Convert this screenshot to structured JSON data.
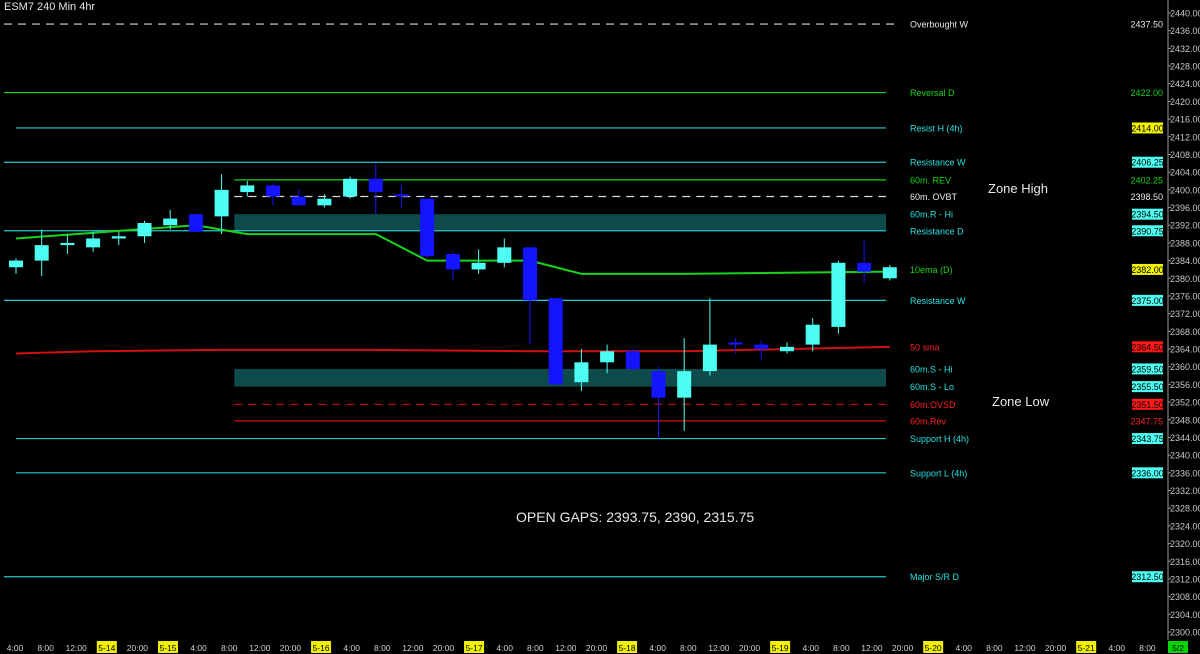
{
  "header": {
    "title": "ESM7 240 Min  4hr"
  },
  "notes": {
    "zone_high": "Zone High",
    "zone_low": "Zone Low",
    "open_gaps": "OPEN GAPS: 2393.75, 2390, 2315.75"
  },
  "colors": {
    "background": "#000000",
    "cyan": "#28c8c8",
    "green": "#19d419",
    "red": "#d01010",
    "bull_candle": "#4dfff2",
    "bear_candle": "#1414ff",
    "zone_fill": "#0f4a4a",
    "yellow_badge": "#f2f200",
    "red_badge": "#ff1a1a"
  },
  "chart_data": {
    "type": "candlestick",
    "title": "ESM7 240 Min  4hr",
    "ylim": [
      2298,
      2440
    ],
    "y_ticks": [
      2300,
      2304,
      2308,
      2312,
      2316,
      2320,
      2324,
      2328,
      2332,
      2336,
      2340,
      2344,
      2348,
      2352,
      2356,
      2360,
      2364,
      2368,
      2372,
      2376,
      2380,
      2384,
      2388,
      2392,
      2396,
      2400,
      2404,
      2408,
      2412,
      2416,
      2420,
      2424,
      2428,
      2432,
      2436,
      2440
    ],
    "x_tick_labels": [
      {
        "label": "4:00",
        "hl": false
      },
      {
        "label": "8:00",
        "hl": false
      },
      {
        "label": "12:00",
        "hl": false
      },
      {
        "label": "5-14",
        "hl": true
      },
      {
        "label": "20:00",
        "hl": false
      },
      {
        "label": "5-15",
        "hl": true
      },
      {
        "label": "4:00",
        "hl": false
      },
      {
        "label": "8:00",
        "hl": false
      },
      {
        "label": "12:00",
        "hl": false
      },
      {
        "label": "20:00",
        "hl": false
      },
      {
        "label": "5-16",
        "hl": true
      },
      {
        "label": "4:00",
        "hl": false
      },
      {
        "label": "8:00",
        "hl": false
      },
      {
        "label": "12:00",
        "hl": false
      },
      {
        "label": "20:00",
        "hl": false
      },
      {
        "label": "5-17",
        "hl": true
      },
      {
        "label": "4:00",
        "hl": false
      },
      {
        "label": "8:00",
        "hl": false
      },
      {
        "label": "12:00",
        "hl": false
      },
      {
        "label": "20:00",
        "hl": false
      },
      {
        "label": "5-18",
        "hl": true
      },
      {
        "label": "4:00",
        "hl": false
      },
      {
        "label": "8:00",
        "hl": false
      },
      {
        "label": "12:00",
        "hl": false
      },
      {
        "label": "20:00",
        "hl": false
      },
      {
        "label": "5-19",
        "hl": true
      },
      {
        "label": "4:00",
        "hl": false
      },
      {
        "label": "8:00",
        "hl": false
      },
      {
        "label": "12:00",
        "hl": false
      },
      {
        "label": "20:00",
        "hl": false
      },
      {
        "label": "5-20",
        "hl": true
      },
      {
        "label": "4:00",
        "hl": false
      },
      {
        "label": "8:00",
        "hl": false
      },
      {
        "label": "12:00",
        "hl": false
      },
      {
        "label": "20:00",
        "hl": false
      },
      {
        "label": "5-21",
        "hl": true
      },
      {
        "label": "4:00",
        "hl": false
      },
      {
        "label": "8:00",
        "hl": false
      },
      {
        "label": "5/2",
        "hl": "green"
      }
    ],
    "candles": [
      {
        "i": 0,
        "o": 2382.5,
        "h": 2384.5,
        "l": 2381.0,
        "c": 2384.0
      },
      {
        "i": 1,
        "o": 2384.0,
        "h": 2391.0,
        "l": 2380.5,
        "c": 2387.5
      },
      {
        "i": 2,
        "o": 2387.5,
        "h": 2390.0,
        "l": 2385.5,
        "c": 2388.0
      },
      {
        "i": 3,
        "o": 2387.0,
        "h": 2390.5,
        "l": 2386.0,
        "c": 2389.0
      },
      {
        "i": 4,
        "o": 2389.0,
        "h": 2390.5,
        "l": 2387.5,
        "c": 2389.5
      },
      {
        "i": 5,
        "o": 2389.5,
        "h": 2393.0,
        "l": 2388.0,
        "c": 2392.5
      },
      {
        "i": 6,
        "o": 2392.0,
        "h": 2395.5,
        "l": 2391.0,
        "c": 2393.5
      },
      {
        "i": 7,
        "o": 2394.5,
        "h": 2394.5,
        "l": 2390.5,
        "c": 2390.5
      },
      {
        "i": 8,
        "o": 2394.0,
        "h": 2403.5,
        "l": 2390.0,
        "c": 2400.0
      },
      {
        "i": 9,
        "o": 2399.5,
        "h": 2402.0,
        "l": 2398.5,
        "c": 2401.0
      },
      {
        "i": 10,
        "o": 2401.0,
        "h": 2401.5,
        "l": 2396.5,
        "c": 2398.5
      },
      {
        "i": 11,
        "o": 2398.5,
        "h": 2400.0,
        "l": 2397.0,
        "c": 2396.5
      },
      {
        "i": 12,
        "o": 2396.5,
        "h": 2399.0,
        "l": 2396.0,
        "c": 2398.0
      },
      {
        "i": 13,
        "o": 2398.5,
        "h": 2403.0,
        "l": 2398.0,
        "c": 2402.5
      },
      {
        "i": 14,
        "o": 2402.5,
        "h": 2406.0,
        "l": 2394.5,
        "c": 2399.5
      },
      {
        "i": 15,
        "o": 2399.0,
        "h": 2401.0,
        "l": 2396.0,
        "c": 2398.5
      },
      {
        "i": 16,
        "o": 2398.0,
        "h": 2398.0,
        "l": 2384.5,
        "c": 2385.0
      },
      {
        "i": 17,
        "o": 2385.5,
        "h": 2386.0,
        "l": 2379.5,
        "c": 2382.0
      },
      {
        "i": 18,
        "o": 2382.0,
        "h": 2386.5,
        "l": 2381.0,
        "c": 2383.5
      },
      {
        "i": 19,
        "o": 2383.5,
        "h": 2389.0,
        "l": 2382.5,
        "c": 2387.0
      },
      {
        "i": 20,
        "o": 2387.0,
        "h": 2387.0,
        "l": 2365.0,
        "c": 2375.0
      },
      {
        "i": 21,
        "o": 2375.5,
        "h": 2375.5,
        "l": 2356.0,
        "c": 2356.0
      },
      {
        "i": 22,
        "o": 2356.5,
        "h": 2364.0,
        "l": 2354.5,
        "c": 2361.0
      },
      {
        "i": 23,
        "o": 2361.0,
        "h": 2365.0,
        "l": 2358.5,
        "c": 2363.5
      },
      {
        "i": 24,
        "o": 2363.5,
        "h": 2364.0,
        "l": 2359.0,
        "c": 2359.5
      },
      {
        "i": 25,
        "o": 2359.0,
        "h": 2360.0,
        "l": 2343.5,
        "c": 2353.0
      },
      {
        "i": 26,
        "o": 2353.0,
        "h": 2366.5,
        "l": 2345.5,
        "c": 2359.0
      },
      {
        "i": 27,
        "o": 2359.0,
        "h": 2375.5,
        "l": 2358.0,
        "c": 2365.0
      },
      {
        "i": 28,
        "o": 2365.5,
        "h": 2366.5,
        "l": 2363.0,
        "c": 2365.0
      },
      {
        "i": 29,
        "o": 2365.0,
        "h": 2366.0,
        "l": 2361.5,
        "c": 2364.0
      },
      {
        "i": 30,
        "o": 2363.5,
        "h": 2365.5,
        "l": 2363.0,
        "c": 2364.5
      },
      {
        "i": 31,
        "o": 2365.0,
        "h": 2371.0,
        "l": 2363.5,
        "c": 2369.5
      },
      {
        "i": 32,
        "o": 2369.0,
        "h": 2384.0,
        "l": 2367.5,
        "c": 2383.5
      },
      {
        "i": 33,
        "o": 2383.5,
        "h": 2388.5,
        "l": 2379.0,
        "c": 2381.5
      },
      {
        "i": 34,
        "o": 2380.0,
        "h": 2383.0,
        "l": 2379.5,
        "c": 2382.5
      }
    ],
    "series": [
      {
        "name": "10ema (D)",
        "points": [
          [
            0,
            2389
          ],
          [
            7,
            2392
          ],
          [
            9,
            2390
          ],
          [
            14,
            2390
          ],
          [
            16,
            2384
          ],
          [
            20,
            2384
          ],
          [
            22,
            2381
          ],
          [
            26,
            2381
          ],
          [
            34,
            2381.5
          ]
        ]
      },
      {
        "name": "50 sma",
        "points": [
          [
            0,
            2363
          ],
          [
            3,
            2363.5
          ],
          [
            8,
            2363.8
          ],
          [
            14,
            2363.8
          ],
          [
            20,
            2363.5
          ],
          [
            26,
            2363.5
          ],
          [
            34,
            2364.5
          ]
        ]
      }
    ],
    "levels": [
      {
        "label": "Overbought W",
        "value": 2437.5,
        "value_text": "2437.50",
        "style": "dash",
        "color": "#d8d8d8",
        "badge": "none",
        "x0": 0,
        "label_color": "#e8e8e8"
      },
      {
        "label": "Reversal D",
        "value": 2422,
        "value_text": "2422.00",
        "style": "solid",
        "color": "#19d419",
        "badge": "none",
        "x0": 0,
        "label_color": "#19d419",
        "value_color": "#19d419"
      },
      {
        "label": "Resist H (4h)",
        "value": 2414,
        "value_text": "2414.00",
        "style": "solid",
        "color": "#28c8c8",
        "badge": "yellow",
        "x0": 0.5,
        "label_color": "#28e0e0"
      },
      {
        "label": "Resistance W",
        "value": 2406.25,
        "value_text": "2406.25",
        "style": "solid",
        "color": "#28c8c8",
        "badge": "cyan",
        "x0": 0,
        "label_color": "#28e0e0"
      },
      {
        "label": "60m. REV",
        "value": 2402.25,
        "value_text": "2402.25",
        "style": "solid",
        "color": "#19d419",
        "badge": "none",
        "x0": 9,
        "label_color": "#19d419",
        "value_color": "#19d419"
      },
      {
        "label": "60m. OVBT",
        "value": 2398.5,
        "value_text": "2398.50",
        "style": "dash",
        "color": "#d8d8d8",
        "badge": "none",
        "x0": 9,
        "label_color": "#e8e8e8"
      },
      {
        "label": "60m.R - Hi",
        "value": 2394.5,
        "value_text": "2394.50",
        "style": "none",
        "color": "#28c8c8",
        "badge": "cyan",
        "x0": 9,
        "label_color": "#28e0e0"
      },
      {
        "label": "Resistance D",
        "value": 2390.75,
        "value_text": "2390.75",
        "style": "solid",
        "color": "#28c8c8",
        "badge": "cyan",
        "x0": 0,
        "label_color": "#28e0e0"
      },
      {
        "label": "10ema (D)",
        "value": 2382,
        "value_text": "2382.00",
        "style": "none",
        "color": "#19d419",
        "badge": "yellow",
        "x0": 0,
        "label_color": "#19d419"
      },
      {
        "label": "Resistance W",
        "value": 2375,
        "value_text": "2375.00",
        "style": "solid",
        "color": "#28c8c8",
        "badge": "cyan",
        "x0": 0,
        "label_color": "#28e0e0"
      },
      {
        "label": "50 sma",
        "value": 2364.5,
        "value_text": "2364.50",
        "style": "none",
        "color": "#d01010",
        "badge": "red",
        "x0": 0,
        "label_color": "#ff2020"
      },
      {
        "label": "60m.S - Hi",
        "value": 2359.5,
        "value_text": "2359.50",
        "style": "none",
        "color": "#28c8c8",
        "badge": "cyan",
        "x0": 9,
        "label_color": "#28e0e0"
      },
      {
        "label": "60m.S - Lo",
        "value": 2355.5,
        "value_text": "2355.50",
        "style": "none",
        "color": "#28c8c8",
        "badge": "cyan",
        "x0": 9,
        "label_color": "#28e0e0"
      },
      {
        "label": "60m.OVSD",
        "value": 2351.5,
        "value_text": "2351.50",
        "style": "dash",
        "color": "#d01010",
        "badge": "red",
        "x0": 9,
        "label_color": "#ff2020"
      },
      {
        "label": "60m.Rev",
        "value": 2347.75,
        "value_text": "2347.75",
        "style": "solid",
        "color": "#d01010",
        "badge": "none",
        "x0": 9,
        "label_color": "#ff2020",
        "value_color": "#ff2020"
      },
      {
        "label": "Support H (4h)",
        "value": 2343.75,
        "value_text": "2343.75",
        "style": "solid",
        "color": "#28c8c8",
        "badge": "cyan",
        "x0": 0.5,
        "label_color": "#28e0e0"
      },
      {
        "label": "Support L (4h)",
        "value": 2336,
        "value_text": "2336.00",
        "style": "solid",
        "color": "#28c8c8",
        "badge": "cyan",
        "x0": 0.5,
        "label_color": "#28e0e0"
      },
      {
        "label": "Major S/R D",
        "value": 2312.5,
        "value_text": "2312.50",
        "style": "solid",
        "color": "#28c8c8",
        "badge": "cyan",
        "x0": 0,
        "label_color": "#28e0e0"
      }
    ],
    "zones": [
      {
        "from_i": 9,
        "top": 2394.5,
        "bottom": 2390.75
      },
      {
        "from_i": 9,
        "top": 2359.5,
        "bottom": 2355.5
      }
    ]
  }
}
